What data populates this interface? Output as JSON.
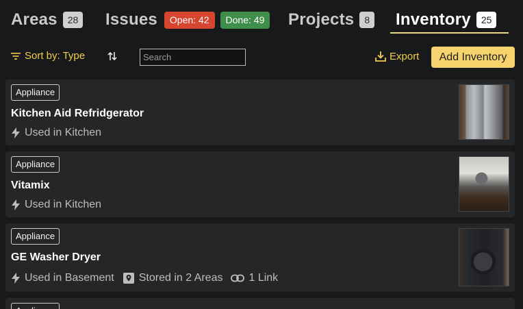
{
  "tabs": [
    {
      "label": "Areas",
      "count": "28"
    },
    {
      "label": "Issues",
      "open_label": "Open: 42",
      "done_label": "Done: 49"
    },
    {
      "label": "Projects",
      "count": "8"
    },
    {
      "label": "Inventory",
      "count": "25",
      "active": true
    }
  ],
  "toolbar": {
    "sort_label": "Sort by: Type",
    "search_placeholder": "Search",
    "search_value": "",
    "export_label": "Export",
    "add_label": "Add Inventory"
  },
  "items": [
    {
      "type": "Appliance",
      "name": "Kitchen Aid Refridgerator",
      "used_in": "Used in Kitchen",
      "thumbnail_icon": "refrigerator-photo"
    },
    {
      "type": "Appliance",
      "name": "Vitamix",
      "used_in": "Used in Kitchen",
      "thumbnail_icon": "blender-photo"
    },
    {
      "type": "Appliance",
      "name": "GE Washer Dryer",
      "used_in": "Used in Basement",
      "stored_in": "Stored in 2 Areas",
      "links": "1 Link",
      "thumbnail_icon": "washer-dryer-photo"
    },
    {
      "type": "Appliance"
    }
  ],
  "colors": {
    "background": "#18191b",
    "card": "#252628",
    "accent": "#f3cd4d",
    "add_button": "#f6d36c",
    "open_badge": "#d6452f",
    "done_badge": "#3f8e4a"
  }
}
